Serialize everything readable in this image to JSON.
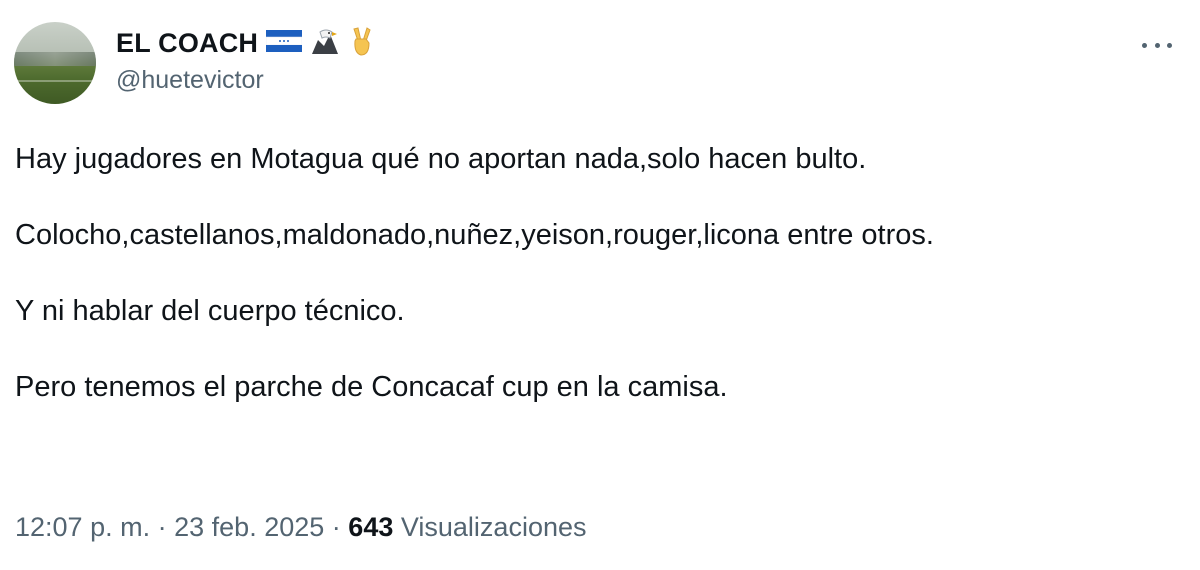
{
  "tweet": {
    "display_name": "EL COACH",
    "handle": "@huetevictor",
    "name_emojis": [
      "honduras-flag-icon",
      "eagle-icon",
      "victory-hand-icon"
    ],
    "paragraphs": [
      "Hay jugadores en Motagua qué no aportan nada,solo hacen bulto.",
      "Colocho,castellanos,maldonado,nuñez,yeison,rouger,licona entre otros.",
      "Y ni hablar del cuerpo técnico.",
      "Pero tenemos el parche de Concacaf cup en la camisa."
    ],
    "time": "12:07 p. m.",
    "separator": "·",
    "date": "23 feb. 2025",
    "views_count": "643",
    "views_label": "Visualizaciones"
  },
  "colors": {
    "text": "#0f1419",
    "secondary": "#536471",
    "flag_blue": "#1d5fbf",
    "victory_yellow": "#f5c451"
  }
}
